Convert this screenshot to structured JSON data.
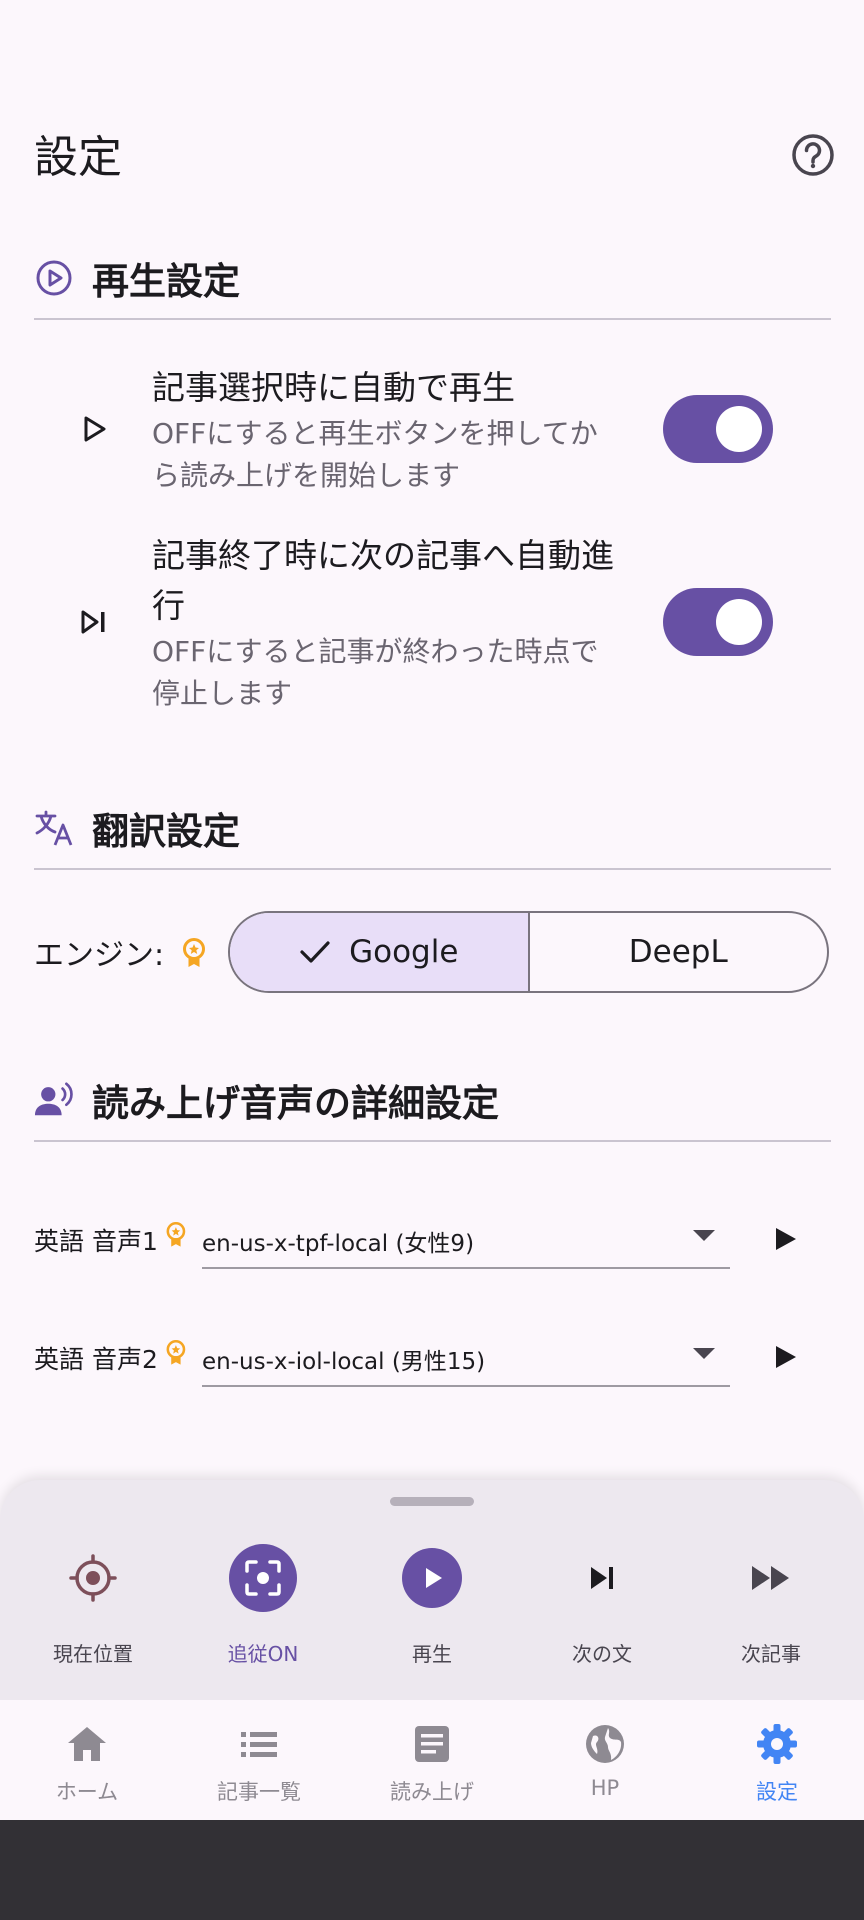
{
  "header": {
    "title": "設定",
    "help_icon": "help-circle-icon"
  },
  "playback": {
    "title": "再生設定",
    "icon": "play-circle-icon",
    "items": [
      {
        "title": "記事選択時に自動で再生",
        "desc": "OFFにすると再生ボタンを押してから読み上げを開始します",
        "icon": "play-icon",
        "on": true
      },
      {
        "title": "記事終了時に次の記事へ自動進行",
        "desc": "OFFにすると記事が終わった時点で停止します",
        "icon": "skip-next-icon",
        "on": true
      }
    ]
  },
  "translation": {
    "title": "翻訳設定",
    "icon": "translate-icon",
    "engine_label": "エンジン:",
    "options": [
      "Google",
      "DeepL"
    ],
    "selected": "Google"
  },
  "voice": {
    "title": "読み上げ音声の詳細設定",
    "icon": "voice-icon",
    "rows": [
      {
        "label": "英語 音声1",
        "value": "en-us-x-tpf-local (女性9)"
      },
      {
        "label": "英語 音声2",
        "value": "en-us-x-iol-local (男性15)"
      }
    ]
  },
  "player": {
    "controls": [
      {
        "label": "現在位置",
        "icon": "target-icon"
      },
      {
        "label": "追従ON",
        "icon": "focus-icon"
      },
      {
        "label": "再生",
        "icon": "play-circle-filled-icon"
      },
      {
        "label": "次の文",
        "icon": "skip-next-icon"
      },
      {
        "label": "次記事",
        "icon": "fast-forward-icon"
      }
    ]
  },
  "bottom_nav": {
    "items": [
      {
        "label": "ホーム",
        "icon": "home-icon"
      },
      {
        "label": "記事一覧",
        "icon": "list-icon"
      },
      {
        "label": "読み上げ",
        "icon": "article-icon"
      },
      {
        "label": "HP",
        "icon": "globe-icon"
      },
      {
        "label": "設定",
        "icon": "gear-icon"
      }
    ],
    "active": "設定"
  },
  "colors": {
    "accent": "#6750A4",
    "nav_active": "#4285F4",
    "badge": "#F5A623",
    "target": "#7D4F5A"
  }
}
